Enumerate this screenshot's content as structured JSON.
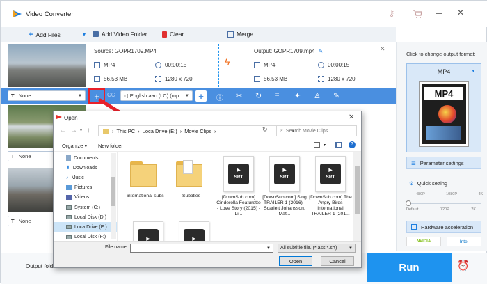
{
  "app": {
    "title": "Video Converter"
  },
  "toolbar": {
    "add_files": "Add Files",
    "add_video_folder": "Add Video Folder",
    "clear": "Clear",
    "merge": "Merge"
  },
  "file": {
    "source": "Source: GOPR1709.MP4",
    "output": "Output: GOPR1709.mp4",
    "format": "MP4",
    "duration": "00:00:15",
    "size": "56.53 MB",
    "resolution": "1280 x 720",
    "out_format": "MP4",
    "out_duration": "00:00:15",
    "out_size": "56.53 MB",
    "out_resolution": "1280 x 720"
  },
  "editbar": {
    "subtitle": "None",
    "audio": "English aac (LC) (mp",
    "cc": "CC"
  },
  "rows": [
    {
      "subtitle": "None"
    },
    {
      "subtitle": "None"
    }
  ],
  "sidebar": {
    "change_output": "Click to change output format:",
    "format": "MP4",
    "format_badge": "MP4",
    "parameter_settings": "Parameter settings",
    "quick_setting": "Quick setting",
    "q_top": [
      "480P",
      "1080P",
      "4K"
    ],
    "q_bottom": [
      "Default",
      "720P",
      "2K"
    ],
    "hw_accel": "Hardware acceleration",
    "nvidia": "NVIDIA",
    "intel": "Intel"
  },
  "bottom": {
    "output_folder": "Output folder",
    "run": "Run"
  },
  "dialog": {
    "title": "Open",
    "breadcrumb": [
      "This PC",
      "Loca Drive (E:)",
      "Movie Clips"
    ],
    "search_placeholder": "Search Movie Clips",
    "organize": "Organize",
    "new_folder": "New folder",
    "tree": [
      "Documents",
      "Downloads",
      "Music",
      "Pictures",
      "Videos",
      "System (C:)",
      "Local Disk (D:)",
      "Loca Drive (E:)",
      "Local Disk (F:)"
    ],
    "files": [
      {
        "name": "international subs",
        "type": "folder"
      },
      {
        "name": "Subtitles",
        "type": "folder"
      },
      {
        "name": "[DownSub.com] Cinderella Featurette - Love Story (2015) - Li...",
        "type": "srt"
      },
      {
        "name": "[DownSub.com] Sing TRAILER 1 (2016) - Scarlett Johansson, Mat...",
        "type": "srt"
      },
      {
        "name": "[DownSub.com] The Angry Birds International TRAILER 1 (201...",
        "type": "srt"
      }
    ],
    "srt_label": "SRT",
    "filename_label": "File name:",
    "filename_value": "",
    "filter": "All subtitle file. (*.ass;*.srt)",
    "open": "Open",
    "cancel": "Cancel"
  },
  "colors": {
    "accent": "#1e93ef",
    "bar": "#4a8fe0",
    "arrow": "#e8202a"
  }
}
